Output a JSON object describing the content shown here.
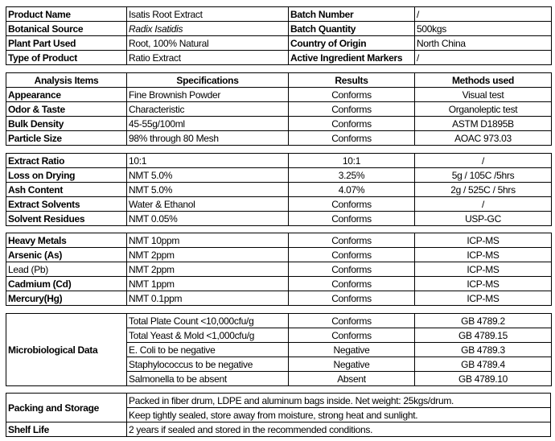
{
  "product_info": [
    [
      "Product Name",
      "Isatis Root Extract",
      "Batch Number",
      "/"
    ],
    [
      "Botanical Source",
      "Radix Isatidis",
      "Batch Quantity",
      "500kgs"
    ],
    [
      "Plant Part Used",
      "Root, 100% Natural",
      "Country of Origin",
      "North China"
    ],
    [
      "Type of Product",
      "Ratio Extract",
      "Active Ingredient  Markers",
      "/"
    ]
  ],
  "analysis": {
    "headers": [
      "Analysis Items",
      "Specifications",
      "Results",
      "Methods used"
    ],
    "rows": [
      [
        "Appearance",
        "Fine Brownish Powder",
        "Conforms",
        "Visual test"
      ],
      [
        "Odor & Taste",
        "Characteristic",
        "Conforms",
        "Organoleptic test"
      ],
      [
        "Bulk Density",
        "45-55g/100ml",
        "Conforms",
        "ASTM D1895B"
      ],
      [
        "Particle Size",
        "98% through 80 Mesh",
        "Conforms",
        "AOAC 973.03"
      ]
    ]
  },
  "physical": [
    [
      "Extract Ratio",
      "10:1",
      "10:1",
      "/"
    ],
    [
      "Loss on Drying",
      "NMT 5.0%",
      "3.25%",
      "5g / 105C /5hrs"
    ],
    [
      "Ash Content",
      "NMT 5.0%",
      "4.07%",
      "2g / 525C / 5hrs"
    ],
    [
      "Extract Solvents",
      "Water & Ethanol",
      "Conforms",
      "/"
    ],
    [
      "Solvent Residues",
      "NMT 0.05%",
      "Conforms",
      "USP-GC"
    ]
  ],
  "metals": [
    [
      "Heavy Metals",
      "NMT 10ppm",
      "Conforms",
      "ICP-MS"
    ],
    [
      "Arsenic (As)",
      "NMT 2ppm",
      "Conforms",
      "ICP-MS"
    ],
    [
      "Lead (Pb)",
      "NMT 2ppm",
      "Conforms",
      "ICP-MS"
    ],
    [
      "Cadmium (Cd)",
      "NMT 1ppm",
      "Conforms",
      "ICP-MS"
    ],
    [
      "Mercury(Hg)",
      "NMT 0.1ppm",
      "Conforms",
      "ICP-MS"
    ]
  ],
  "micro": {
    "label": "Microbiological Data",
    "rows": [
      [
        "Total Plate Count <10,000cfu/g",
        "Conforms",
        "GB 4789.2"
      ],
      [
        "Total Yeast & Mold <1,000cfu/g",
        "Conforms",
        "GB 4789.15"
      ],
      [
        "E. Coli to be negative",
        "Negative",
        "GB 4789.3"
      ],
      [
        "Staphylococcus to be negative",
        "Negative",
        "GB 4789.4"
      ],
      [
        "Salmonella to be absent",
        "Absent",
        "GB 4789.10"
      ]
    ]
  },
  "packing": {
    "label": "Packing and Storage",
    "lines": [
      "Packed in fiber drum, LDPE and aluminum bags inside. Net weight: 25kgs/drum.",
      "Keep tightly sealed, store away from moisture, strong heat and sunlight."
    ],
    "shelf_label": "Shelf Life",
    "shelf_value": "2 years if sealed and stored in the recommended conditions."
  }
}
